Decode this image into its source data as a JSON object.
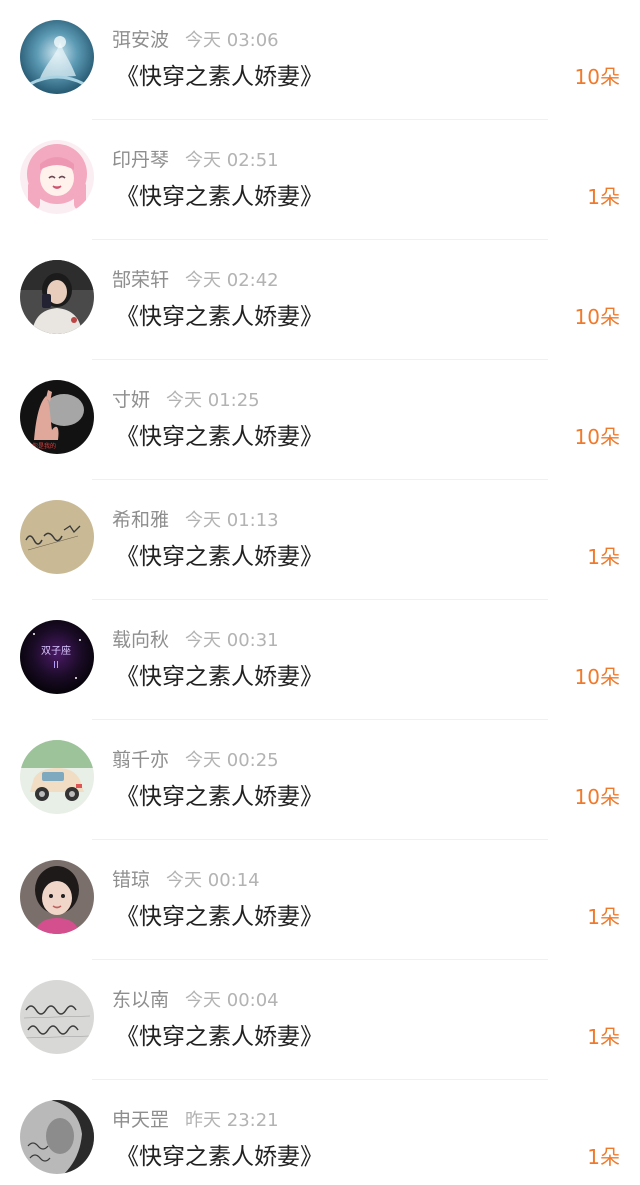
{
  "accent_color": "#f07a2c",
  "items": [
    {
      "name": "弭安波",
      "time": "今天 03:06",
      "book": "《快穿之素人娇妻》",
      "gift": "10朵",
      "avatar": "water-splash-avatar"
    },
    {
      "name": "印丹琴",
      "time": "今天 02:51",
      "book": "《快穿之素人娇妻》",
      "gift": "1朵",
      "avatar": "pink-anime-girl-avatar"
    },
    {
      "name": "郜荣轩",
      "time": "今天 02:42",
      "book": "《快穿之素人娇妻》",
      "gift": "10朵",
      "avatar": "girl-photo-avatar"
    },
    {
      "name": "寸妍",
      "time": "今天 01:25",
      "book": "《快穿之素人娇妻》",
      "gift": "10朵",
      "avatar": "hand-smoke-avatar"
    },
    {
      "name": "希和雅",
      "time": "今天 01:13",
      "book": "《快穿之素人娇妻》",
      "gift": "1朵",
      "avatar": "handwriting-beige-avatar"
    },
    {
      "name": "载向秋",
      "time": "今天 00:31",
      "book": "《快穿之素人娇妻》",
      "gift": "10朵",
      "avatar": "gemini-neon-avatar"
    },
    {
      "name": "翦千亦",
      "time": "今天 00:25",
      "book": "《快穿之素人娇妻》",
      "gift": "10朵",
      "avatar": "toy-car-avatar"
    },
    {
      "name": "错琼",
      "time": "今天 00:14",
      "book": "《快穿之素人娇妻》",
      "gift": "1朵",
      "avatar": "child-photo-avatar"
    },
    {
      "name": "东以南",
      "time": "今天 00:04",
      "book": "《快穿之素人娇妻》",
      "gift": "1朵",
      "avatar": "handwriting-gray-avatar"
    },
    {
      "name": "申天罡",
      "time": "昨天 23:21",
      "book": "《快穿之素人娇妻》",
      "gift": "1朵",
      "avatar": "dark-portrait-avatar"
    }
  ]
}
